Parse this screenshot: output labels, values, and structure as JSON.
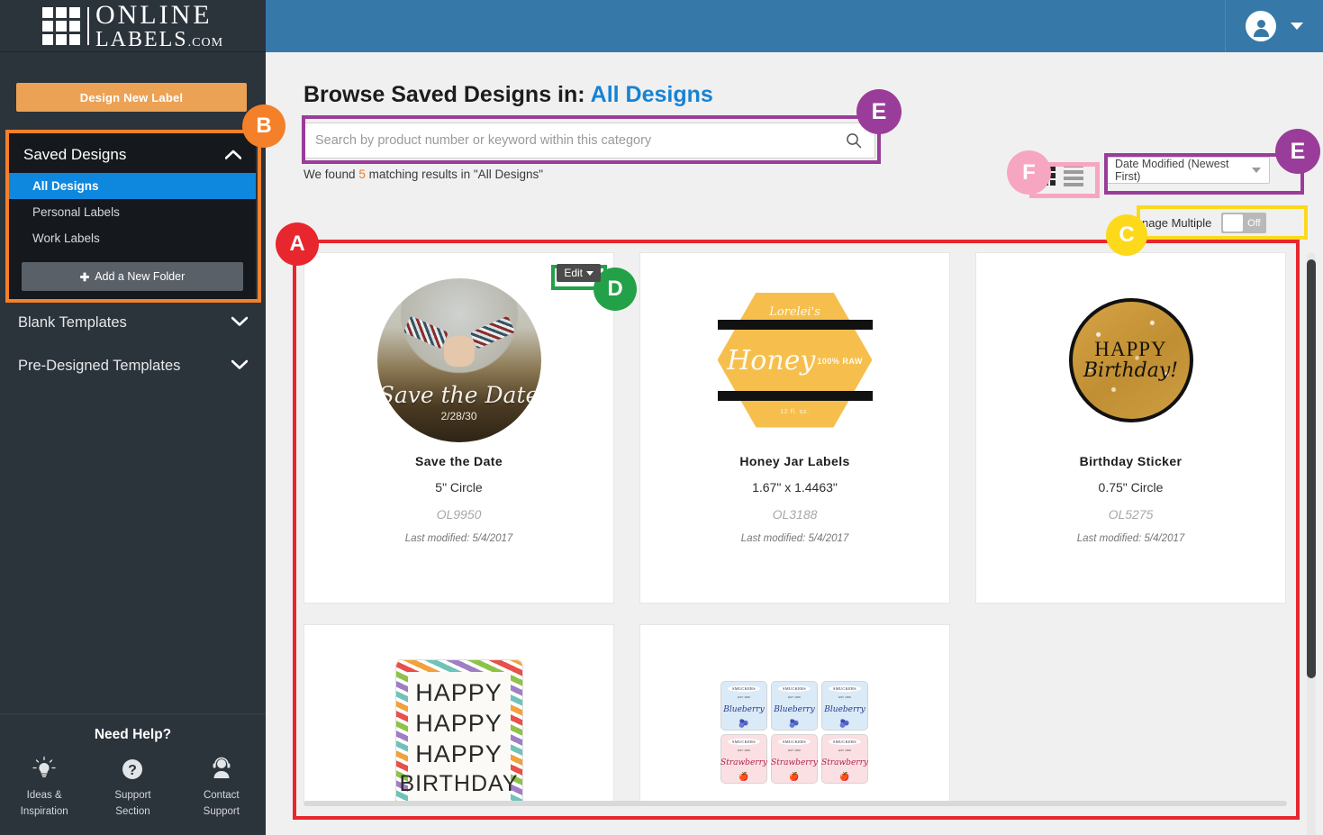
{
  "brand": {
    "logo_primary": "ONLINE",
    "logo_secondary": "LABELS",
    "logo_tld": ".COM",
    "logo_icon": "grid-logo-icon"
  },
  "sidebar": {
    "design_new_label": "Design New Label",
    "saved_designs": {
      "title": "Saved Designs",
      "collapse_icon": "chevron-up-icon",
      "items": [
        {
          "label": "All Designs",
          "active": true
        },
        {
          "label": "Personal Labels",
          "active": false
        },
        {
          "label": "Work Labels",
          "active": false
        }
      ],
      "add_folder_label": "Add a New Folder",
      "add_folder_icon": "plus-icon"
    },
    "sections": [
      {
        "label": "Blank Templates",
        "icon": "chevron-down-icon"
      },
      {
        "label": "Pre-Designed Templates",
        "icon": "chevron-down-icon"
      }
    ],
    "help": {
      "title": "Need Help?",
      "items": [
        {
          "label": "Ideas &\nInspiration",
          "line1": "Ideas &",
          "line2": "Inspiration",
          "icon": "lightbulb-icon"
        },
        {
          "label": "Support Section",
          "line1": "Support",
          "line2": "Section",
          "icon": "question-mark-icon"
        },
        {
          "label": "Contact Support",
          "line1": "Contact",
          "line2": "Support",
          "icon": "headset-agent-icon"
        }
      ]
    }
  },
  "topbar": {
    "account_icon": "user-avatar-icon",
    "dropdown_icon": "chevron-down-icon"
  },
  "main": {
    "title_prefix": "Browse Saved Designs in:",
    "title_category": "All Designs",
    "search": {
      "placeholder": "Search by product number or keyword within this category",
      "value": "",
      "icon": "search-icon"
    },
    "results": {
      "prefix": "We found",
      "count": "5",
      "suffix": "matching results in \"All Designs\""
    },
    "view_toggle": {
      "grid_icon": "grid-view-icon",
      "list_icon": "list-view-icon",
      "active": "grid"
    },
    "sort": {
      "selected": "Date Modified (Newest First)",
      "icon": "chevron-down-icon"
    },
    "manage_multiple": {
      "label": "Manage Multiple",
      "state": "Off"
    },
    "edit_button": {
      "label": "Edit",
      "icon": "caret-down-icon"
    },
    "designs": [
      {
        "title": "Save the Date",
        "size": "5\" Circle",
        "sku": "OL9950",
        "modified": "Last modified: 5/4/2017",
        "art": {
          "kind": "photo-circle",
          "headline": "Save the Date",
          "subline": "2/28/30"
        }
      },
      {
        "title": "Honey Jar Labels",
        "size": "1.67\" x 1.4463\"",
        "sku": "OL3188",
        "modified": "Last modified: 5/4/2017",
        "art": {
          "kind": "hexagon",
          "top_text": "Lorelei's",
          "badge_text": "100% RAW",
          "headline": "Honey",
          "bottom_text": "12 fl. oz."
        }
      },
      {
        "title": "Birthday Sticker",
        "size": "0.75\" Circle",
        "sku": "OL5275",
        "modified": "Last modified: 5/4/2017",
        "art": {
          "kind": "glitter-circle",
          "line1": "HAPPY",
          "line2": "Birthday!"
        }
      },
      {
        "title": "",
        "size": "",
        "sku": "",
        "modified": "",
        "art": {
          "kind": "rainbow-border-card",
          "line1": "HAPPY",
          "line2": "HAPPY",
          "line3": "HAPPY",
          "line4": "BIRTHDAY"
        }
      },
      {
        "title": "",
        "size": "",
        "sku": "",
        "modified": "",
        "art": {
          "kind": "label-sheet",
          "brand": "SMUCKERS",
          "est": "EST. 1906",
          "flavor_blue": "Blueberry",
          "flavor_pink": "Strawberry"
        }
      }
    ]
  },
  "annotations": [
    {
      "letter": "A",
      "color": "#e8262d",
      "target": "designs-grid-region"
    },
    {
      "letter": "B",
      "color": "#f4802a",
      "target": "saved-designs-panel"
    },
    {
      "letter": "C",
      "color": "#fcd91b",
      "target": "manage-multiple-toggle"
    },
    {
      "letter": "D",
      "color": "#22a148",
      "target": "edit-button"
    },
    {
      "letter": "E",
      "color": "#9a3d9a",
      "target": "search-and-sort"
    },
    {
      "letter": "F",
      "color": "#f6a6c1",
      "target": "view-toggle"
    }
  ]
}
